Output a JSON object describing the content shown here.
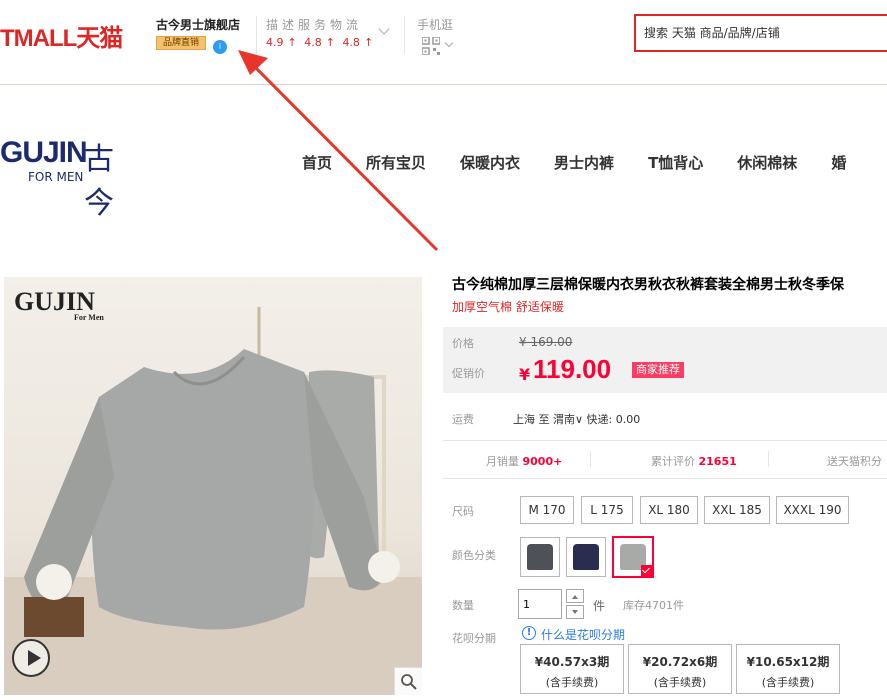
{
  "header": {
    "tmall_logo": "TMALL天猫",
    "store_name": "古今男士旗舰店",
    "store_badge": "品牌直销",
    "rating_labels": "描述服务物流",
    "ratings": [
      "4.9",
      "4.8",
      "4.8"
    ],
    "mobile_label": "手机逛",
    "search_placeholder": "搜索 天猫 商品/品牌/店铺"
  },
  "brand": {
    "logo_text": "GUJIN",
    "logo_cn": "古今",
    "logo_sub": "FOR MEN"
  },
  "nav": {
    "items": [
      "首页",
      "所有宝贝",
      "保暖内衣",
      "男士内裤",
      "T恤背心",
      "休闲棉袜",
      "婚"
    ]
  },
  "image": {
    "logo": "GUJIN",
    "logo_sub": "For Men"
  },
  "product": {
    "title": "古今纯棉加厚三层棉保暖内衣男秋衣秋裤套装全棉男士秋冬季保",
    "subtitle": "加厚空气棉 舒适保暖",
    "orig_label": "价格",
    "orig_price": "¥ 169.00",
    "promo_label": "促销价",
    "currency": "¥",
    "promo_price": "119.00",
    "promo_tag": "商家推荐",
    "ship_label": "运费",
    "ship_text": "上海  至  渭南∨  快递: 0.00",
    "stats": {
      "monthly_label": "月销量",
      "monthly_value": "9000+",
      "reviews_label": "累计评价",
      "reviews_value": "21651",
      "points_label": "送天猫积分"
    },
    "size_label": "尺码",
    "sizes": [
      "M 170",
      "L 175",
      "XL 180",
      "XXL 185",
      "XXXL 190"
    ],
    "color_label": "颜色分类",
    "colors": [
      "#4e5258",
      "#2a2d4f",
      "#a8aaa8"
    ],
    "qty_label": "数量",
    "qty_value": "1",
    "qty_unit": "件",
    "stock": "库存4701件",
    "huabei_label": "花呗分期",
    "huabei_link": "什么是花呗分期",
    "plans": [
      {
        "amount": "¥40.57x3期",
        "fee": "(含手续费)"
      },
      {
        "amount": "¥20.72x6期",
        "fee": "(含手续费)"
      },
      {
        "amount": "¥10.65x12期",
        "fee": "(含手续费)"
      }
    ]
  },
  "colors": {
    "accent": "#dd2727",
    "price": "#ff0036",
    "link": "#2c7be5",
    "arrow": "#e8352b"
  }
}
